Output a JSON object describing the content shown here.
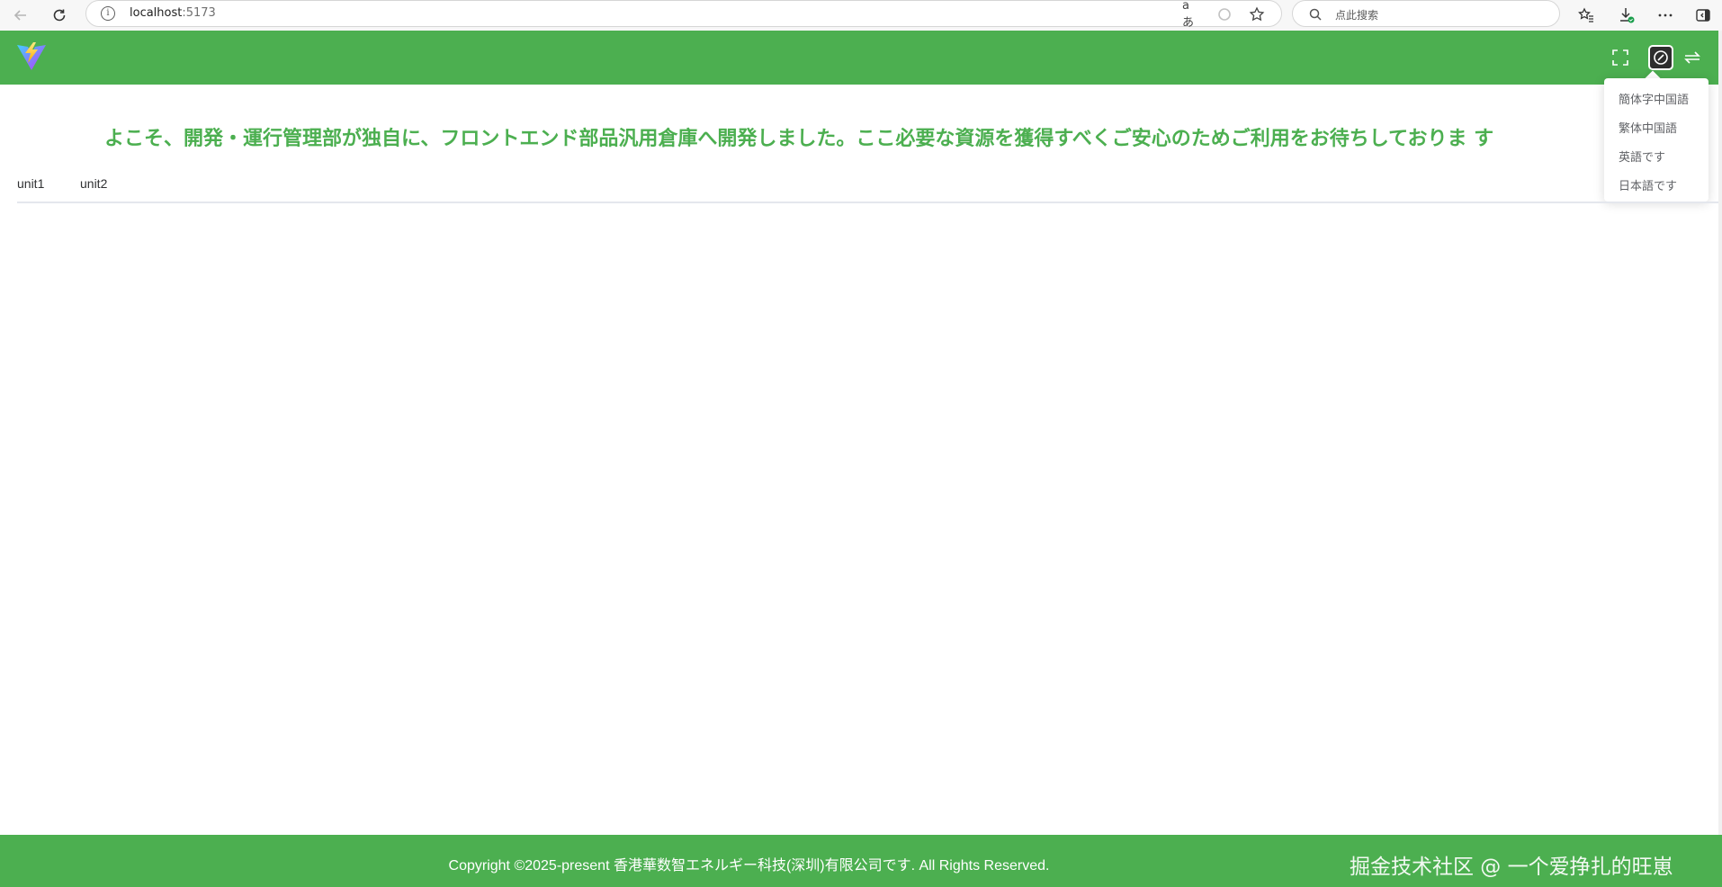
{
  "browser": {
    "url_host": "localhost",
    "url_port": ":5173",
    "search_placeholder": "点此搜索",
    "read_aloud_label": "aあ"
  },
  "header": {
    "bg_color": "#4caf50",
    "icons": [
      "fullscreen-icon",
      "language-icon",
      "switch-icon"
    ]
  },
  "language_menu": {
    "items": [
      "簡体字中国語",
      "繁体中国語",
      "英語です",
      "日本語です"
    ]
  },
  "main": {
    "welcome": "よこそ、開発・運行管理部が独自に、フロントエンド部品汎用倉庫へ開発しました。ここ必要な資源を獲得すべくご安心のためご利用をお待ちしておりま す",
    "tabs": [
      "unit1",
      "unit2"
    ]
  },
  "footer": {
    "copyright": "Copyright ©2025-present 香港華数智エネルギー科技(深圳)有限公司です. All Rights Reserved.",
    "watermark": "掘金技术社区 @ 一个爱挣扎的旺崽"
  }
}
